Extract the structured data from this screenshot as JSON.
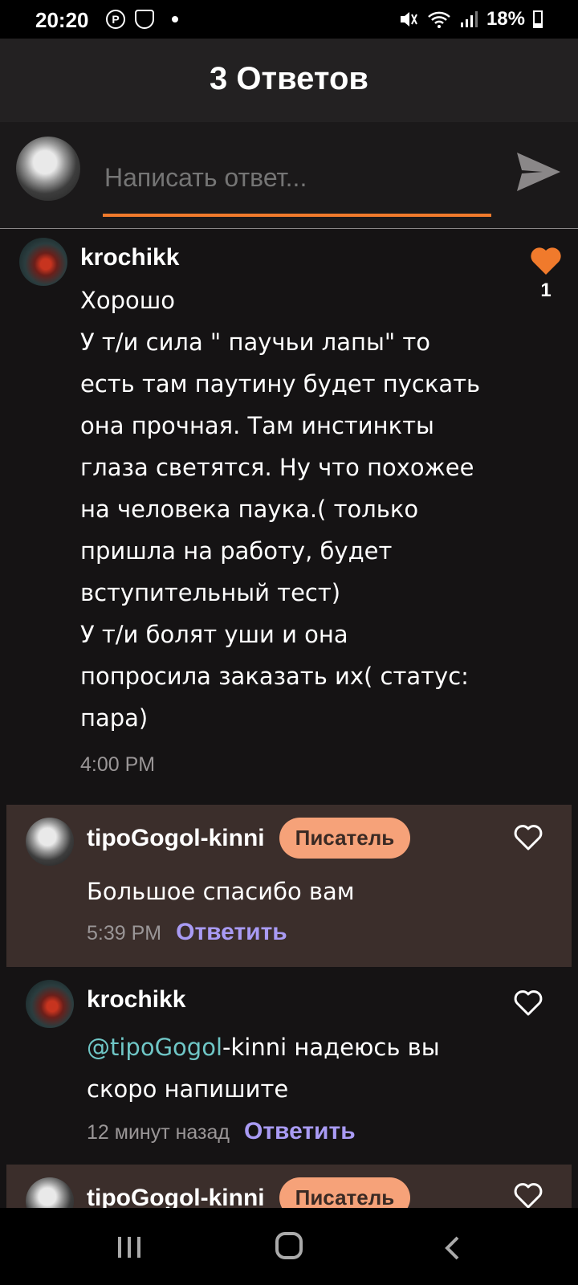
{
  "status_bar": {
    "time": "20:20",
    "battery": "18%",
    "left_icons": [
      "pinterest-icon",
      "shield-icon"
    ],
    "right_icons": [
      "mute-icon",
      "wifi-icon",
      "signal-icon",
      "battery-icon"
    ]
  },
  "header": {
    "title": "3 Ответов"
  },
  "reply_bar": {
    "placeholder": "Написать ответ...",
    "accent_color": "#f07a2c",
    "send_icon": "send-icon"
  },
  "main_comment": {
    "author": "krochikk",
    "lines": [
      "Хорошо",
      "У т/и сила \" паучьи лапы\" то",
      "есть там паутину будет пускать",
      "она прочная. Там инстинкты",
      "глаза светятся. Ну что похожее",
      "на человека паука.( только",
      "пришла на работу, будет",
      "вступительный тест)",
      "У т/и болят уши и она",
      "попросила заказать их( статус:",
      "пара)"
    ],
    "time": "4:00 PM",
    "likes": "1",
    "like_color": "#f07a2c"
  },
  "replies": [
    {
      "author": "tipoGogol-kinni",
      "badge": "Писатель",
      "text": "Большое спасибо вам",
      "time": "5:39 PM",
      "reply_label": "Ответить"
    },
    {
      "author": "krochikk",
      "mention": "@tipoGogol",
      "text_rest": "-kinni  надеюсь вы",
      "text_line2": "скоро напишите",
      "time": "12 минут назад",
      "reply_label": "Ответить"
    },
    {
      "author": "tipoGogol-kinni",
      "badge": "Писатель"
    }
  ],
  "colors": {
    "background": "#151314",
    "writer_reply_bg": "#3b2e2b",
    "badge_bg": "#f6a279",
    "reply_link": "#a99bf4",
    "mention": "#6fc6c6"
  }
}
